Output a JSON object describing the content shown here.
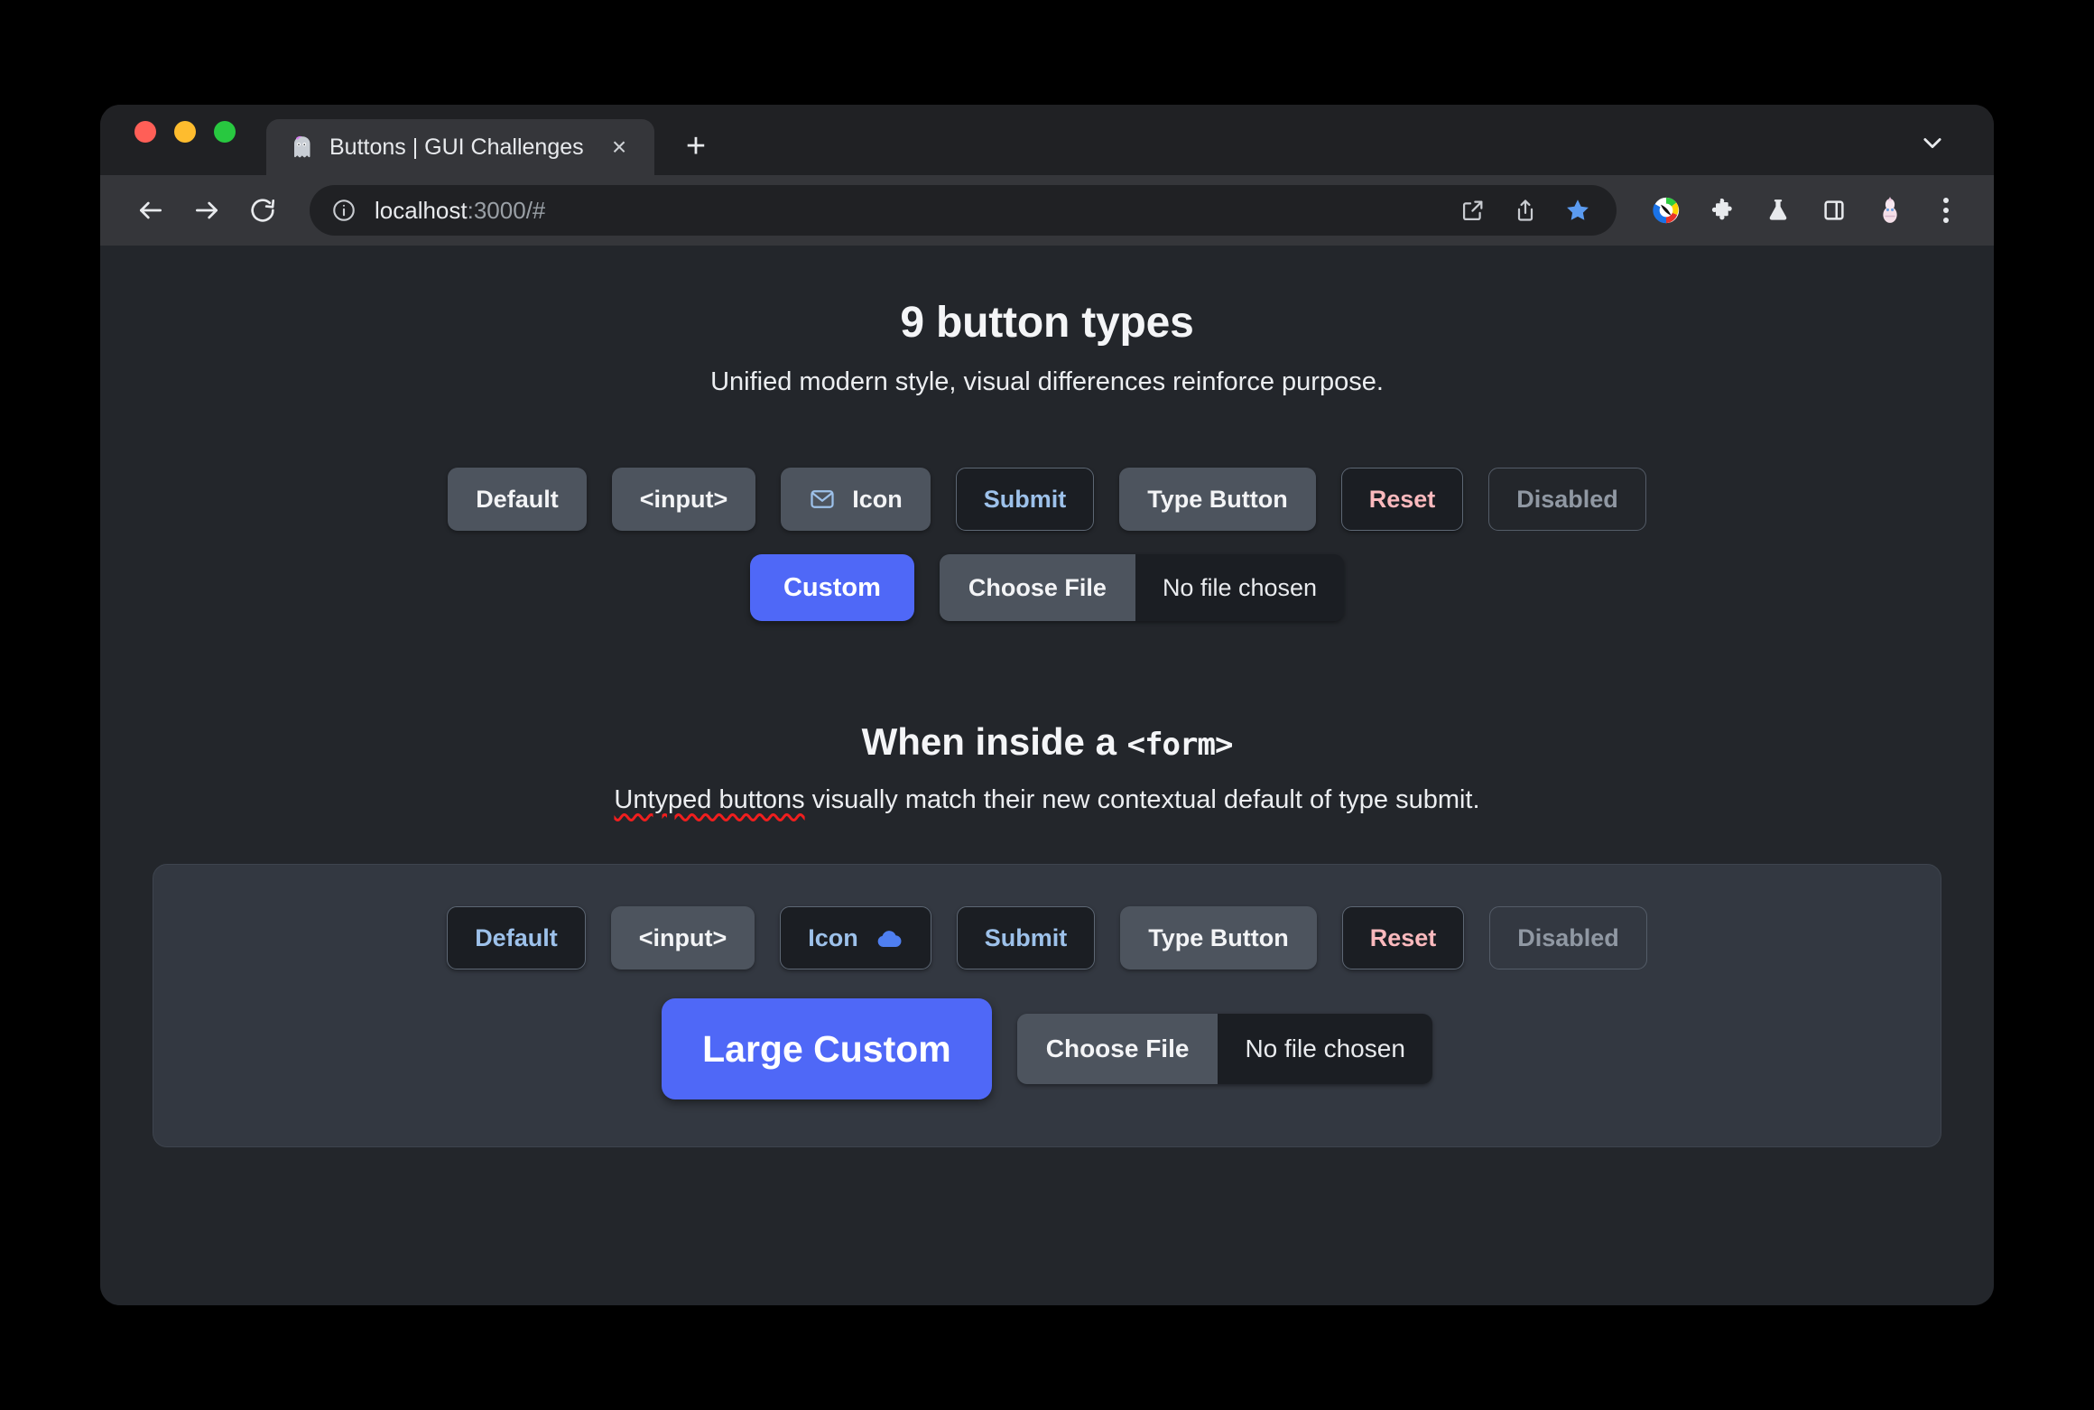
{
  "browser": {
    "traffic_lights": [
      "close",
      "minimize",
      "maximize"
    ],
    "tab": {
      "title": "Buttons | GUI Challenges",
      "favicon": "ghost-icon",
      "close_label": "×"
    },
    "new_tab_label": "+",
    "tabstrip_chevron": "chevron-down-icon",
    "toolbar": {
      "back": "back-arrow-icon",
      "forward": "forward-arrow-icon",
      "reload": "reload-icon",
      "info": "info-icon",
      "url_host": "localhost",
      "url_rest": ":3000/#",
      "open_in_new": "external-link-icon",
      "share": "share-icon",
      "bookmark": "star-icon",
      "bookmark_color": "#5b9bf0",
      "extension_color_circle": "color-circle-icon",
      "extensions": "puzzle-icon",
      "labs": "flask-icon",
      "side_panel": "side-panel-icon",
      "profile": "avatar-icon",
      "menu": "three-dot-menu-icon"
    }
  },
  "page": {
    "background": "#23262b",
    "accent_blue": "#4f68f7",
    "title": "9 button types",
    "subtitle": "Unified modern style, visual differences reinforce purpose.",
    "row1": [
      {
        "label": "Default",
        "style": "gray",
        "icon": null
      },
      {
        "label": "<input>",
        "style": "gray",
        "icon": null
      },
      {
        "label": "Icon",
        "style": "gray",
        "icon": "mail-icon",
        "icon_side": "left"
      },
      {
        "label": "Submit",
        "style": "submit",
        "icon": null
      },
      {
        "label": "Type Button",
        "style": "gray",
        "icon": null
      },
      {
        "label": "Reset",
        "style": "reset",
        "icon": null
      },
      {
        "label": "Disabled",
        "style": "disabled",
        "icon": null
      }
    ],
    "row2": {
      "custom_label": "Custom",
      "file": {
        "choose_label": "Choose File",
        "chosen_label": "No file chosen"
      }
    },
    "form_section": {
      "title_text": "When inside a ",
      "title_mono": "<form>",
      "subtitle_prefix": "",
      "subtitle_spell": "Untyped buttons",
      "subtitle_rest": " visually match their new contextual default of type submit.",
      "row1": [
        {
          "label": "Default",
          "style": "submit",
          "icon": null
        },
        {
          "label": "<input>",
          "style": "gray",
          "icon": null
        },
        {
          "label": "Icon",
          "style": "submit",
          "icon": "cloud-icon",
          "icon_side": "right"
        },
        {
          "label": "Submit",
          "style": "submit",
          "icon": null
        },
        {
          "label": "Type Button",
          "style": "gray",
          "icon": null
        },
        {
          "label": "Reset",
          "style": "reset",
          "icon": null
        },
        {
          "label": "Disabled",
          "style": "disabled",
          "icon": null
        }
      ],
      "row2": {
        "custom_label": "Large Custom",
        "file": {
          "choose_label": "Choose File",
          "chosen_label": "No file chosen"
        }
      }
    }
  }
}
